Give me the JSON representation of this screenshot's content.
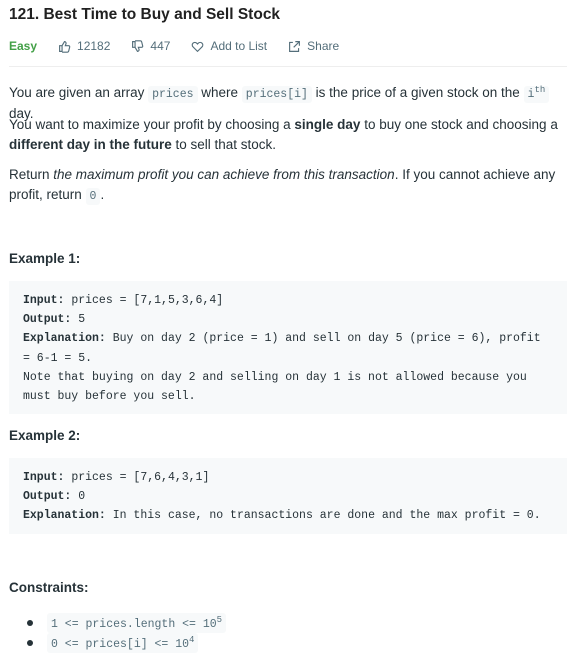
{
  "problem": {
    "title": "121. Best Time to Buy and Sell Stock",
    "difficulty": "Easy",
    "likes": "12182",
    "dislikes": "447",
    "add_to_list": "Add to List",
    "share": "Share"
  },
  "description": {
    "p1_a": "You are given an array ",
    "p1_code1": "prices",
    "p1_b": " where ",
    "p1_code2": "prices[i]",
    "p1_c": " is the price of a given stock on the ",
    "p1_code3": "i",
    "p1_sup": "th",
    "p1_d": " day.",
    "p2_a": "You want to maximize your profit by choosing a ",
    "p2_b": "single day",
    "p2_c": " to buy one stock and choosing a ",
    "p2_d": "different day in the future",
    "p2_e": " to sell that stock.",
    "p3_a": "Return ",
    "p3_b": "the maximum profit you can achieve from this transaction",
    "p3_c": ". If you cannot achieve any profit, return ",
    "p3_code": "0",
    "p3_d": "."
  },
  "example1": {
    "heading": "Example 1:",
    "input_label": "Input:",
    "input_value": " prices = [7,1,5,3,6,4]",
    "output_label": "Output:",
    "output_value": " 5",
    "explanation_label": "Explanation:",
    "explanation_value": " Buy on day 2 (price = 1) and sell on day 5 (price = 6), profit = 6-1 = 5.\nNote that buying on day 2 and selling on day 1 is not allowed because you must buy before you sell."
  },
  "example2": {
    "heading": "Example 2:",
    "input_label": "Input:",
    "input_value": " prices = [7,6,4,3,1]",
    "output_label": "Output:",
    "output_value": " 0",
    "explanation_label": "Explanation:",
    "explanation_value": " In this case, no transactions are done and the max profit = 0."
  },
  "constraints": {
    "heading": "Constraints:",
    "c1": "1 <= prices.length <= 10",
    "c1_exp": "5",
    "c2": "0 <= prices[i] <= 10",
    "c2_exp": "4"
  },
  "colors": {
    "easy": "#43a047",
    "code_bg": "#f7f9fa",
    "text": "#263238"
  }
}
